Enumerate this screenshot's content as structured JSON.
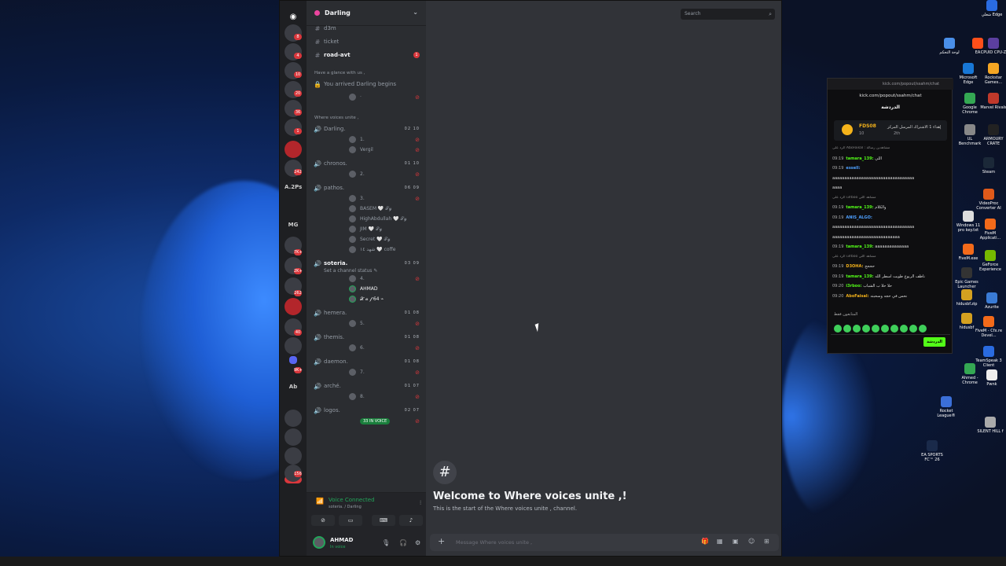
{
  "server": {
    "name": "Darling"
  },
  "channels_top": [
    {
      "name": "d3m"
    },
    {
      "name": "ticket"
    },
    {
      "name": "road-avt",
      "badge": "1"
    }
  ],
  "glance": {
    "category": "Have a glance with us ,",
    "item": "You arrived Darling begins",
    "user": "·"
  },
  "voice_category": "Where voices unite ,",
  "voice_channels": [
    {
      "name": "Darling.",
      "count": "02 10",
      "users": [
        "1.",
        "Vergil"
      ]
    },
    {
      "name": "chronos.",
      "count": "01 10",
      "users": [
        "2."
      ]
    },
    {
      "name": "pathos.",
      "count": "06 09",
      "users": [
        "3.",
        "BASEM 🤍 𝒯𝓎",
        "HighAbdullah 🤍 𝒯𝓎",
        "JIM 🤍 𝒯𝓎",
        "Secret 🤍 𝒯𝓎",
        "شهد ١٤ 🤍 coffe"
      ]
    },
    {
      "name": "soteria.",
      "count": "03 09",
      "status": "Set a channel status ✎",
      "users": [
        "4.",
        "AHMAD",
        "𝒳 𝒶 𝒻 64 ⌁"
      ]
    },
    {
      "name": "hemera.",
      "count": "01 08",
      "users": [
        "5."
      ]
    },
    {
      "name": "themis.",
      "count": "01 08",
      "users": [
        "6."
      ]
    },
    {
      "name": "daemon.",
      "count": "01 08",
      "users": [
        "7."
      ]
    },
    {
      "name": "arché.",
      "count": "01 07",
      "users": [
        "8."
      ]
    },
    {
      "name": "logos.",
      "count": "02 07",
      "users": [
        "33 IN VOICE"
      ]
    }
  ],
  "voice_bar": {
    "status": "Voice Connected",
    "location": "soteria. / Darling"
  },
  "user_panel": {
    "name": "AHMAD",
    "status": "In voice"
  },
  "main": {
    "search_placeholder": "Search",
    "welcome_title": "Welcome to Where voices unite ,!",
    "welcome_sub": "This is the start of the Where voices unite , channel.",
    "composer_placeholder": "Message Where voices unite ,"
  },
  "rail": {
    "labels": [
      "A.2Ps",
      "MG",
      "NEW",
      "Ab Aa"
    ],
    "pings": [
      "8",
      "4",
      "10",
      "20",
      "36",
      "1",
      "242",
      "7K+",
      "2K+",
      "262",
      "40",
      "9K+",
      "156"
    ]
  },
  "kick": {
    "window_title": "kick.com/popout/ssahm/chat",
    "url": "kick.com/popout/ssahm/chat",
    "header": "الدردشة",
    "pinned": {
      "name": "FDS08",
      "sub": "10",
      "message": "إهداء 1 الاشتراك المرسل المركز",
      "time": "2th"
    },
    "messages": [
      {
        "sys": "الرد على AboFaisal : مشاهدين رسالة"
      },
      {
        "time": "09:19",
        "name": "tamara_139",
        "color": "#53fc18",
        "text": "اللي"
      },
      {
        "time": "09:19",
        "name": "essell",
        "color": "#4ea0ff",
        "text": ""
      },
      {
        "time": "",
        "name": "",
        "color": "#ddd",
        "text": "aaaaaaaaaaaaaaaaaaaaaaaaaaaaaaaaaa"
      },
      {
        "time": "",
        "name": "",
        "color": "#ddd",
        "text": "aaaa"
      },
      {
        "sys": "الرد على i3rboo مشاهد اللي"
      },
      {
        "time": "09:19",
        "name": "tamara_139",
        "color": "#53fc18",
        "text": "والكلام"
      },
      {
        "time": "09:19",
        "name": "ANIS_ALGO",
        "color": "#4ea0ff",
        "text": ""
      },
      {
        "time": "",
        "name": "",
        "color": "#ddd",
        "text": "aaaaaaaaaaaaaaaaaaaaaaaaaaaaaaaaaa"
      },
      {
        "time": "",
        "name": "",
        "color": "#ddd",
        "text": "aaaaaaaaaaaaaaaaaaaaaaaaaaaa"
      },
      {
        "time": "09:19",
        "name": "tamara_139",
        "color": "#53fc18",
        "text": "aaaaaaaaaaaaaa"
      },
      {
        "sys": "الرد على i3rboo مشاهد اللي"
      },
      {
        "time": "09:19",
        "name": "D3OHA",
        "color": "#f5b31a",
        "text": "حححح"
      },
      {
        "time": "09:19",
        "name": "tamara_139",
        "color": "#53fc18",
        "text": "ناظف الربوع طويت اسطر الله"
      },
      {
        "time": "09:20",
        "name": "i3rboo",
        "color": "#53fc18",
        "text": "حلا حلا ب الشباب"
      },
      {
        "time": "09:20",
        "name": "AboFaisal",
        "color": "#f5b31a",
        "text": "نحس في حجه وسحبته"
      }
    ],
    "emote_label": "المتابعون فقط",
    "send_label": "الدردشة"
  },
  "desktop_icons": [
    {
      "label": "شغلي Edge"
    },
    {
      "label": "لوحة التحكم"
    },
    {
      "label": "EA"
    },
    {
      "label": "CPUID CPU-Z"
    },
    {
      "label": "Microsoft Edge"
    },
    {
      "label": "Rockstar Games..."
    },
    {
      "label": "Google Chrome"
    },
    {
      "label": "Marvel Rivals"
    },
    {
      "label": "UL Benchmark"
    },
    {
      "label": "ARMOURY CRATE"
    },
    {
      "label": "Steam"
    },
    {
      "label": "VideoProc Converter AI"
    },
    {
      "label": "Windows 11 pro key.txt"
    },
    {
      "label": "FiveM Applicati..."
    },
    {
      "label": "FiveM.exe"
    },
    {
      "label": "GeForce Experience"
    },
    {
      "label": "Epic Games Launcher"
    },
    {
      "label": "hidusbf.zip"
    },
    {
      "label": "Azurite"
    },
    {
      "label": "hidusbf"
    },
    {
      "label": "FiveM - Cfx.re Devel..."
    },
    {
      "label": "TeamSpeak 3 Client"
    },
    {
      "label": "Ahmed - Chrome"
    },
    {
      "label": "Pwnk"
    },
    {
      "label": "Rocket League®"
    },
    {
      "label": "SILENT HILL f"
    },
    {
      "label": "EA SPORTS FC™ 26"
    }
  ]
}
